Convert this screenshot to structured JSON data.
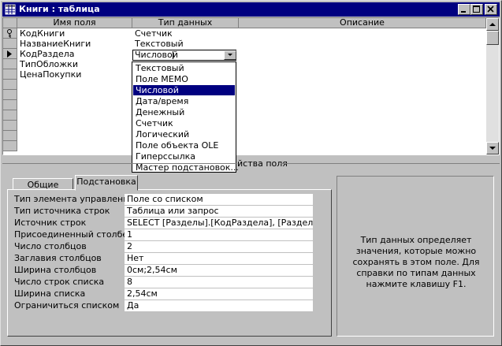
{
  "window": {
    "title": "Книги : таблица"
  },
  "grid": {
    "columns": [
      "Имя поля",
      "Тип данных",
      "Описание"
    ],
    "rows": [
      {
        "name": "КодКниги",
        "type": "Счетчик"
      },
      {
        "name": "НазваниеКниги",
        "type": "Текстовый"
      },
      {
        "name": "КодРаздела",
        "type": "Числовой"
      },
      {
        "name": "ТипОбложки",
        "type": ""
      },
      {
        "name": "ЦенаПокупки",
        "type": ""
      }
    ]
  },
  "dropdown": {
    "items": [
      "Текстовый",
      "Поле MEMO",
      "Числовой",
      "Дата/время",
      "Денежный",
      "Счетчик",
      "Логический",
      "Поле объекта OLE",
      "Гиперссылка",
      "Мастер подстановок..."
    ],
    "selected_index": 2
  },
  "props_label": "йства поля",
  "tabs": {
    "general": "Общие",
    "lookup": "Подстановка"
  },
  "properties": [
    {
      "label": "Тип элемента управления",
      "value": "Поле со списком"
    },
    {
      "label": "Тип источника строк",
      "value": "Таблица или запрос"
    },
    {
      "label": "Источник строк",
      "value": "SELECT [Разделы].[КодРаздела], [Разделы"
    },
    {
      "label": "Присоединенный столбец",
      "value": "1"
    },
    {
      "label": "Число столбцов",
      "value": "2"
    },
    {
      "label": "Заглавия столбцов",
      "value": "Нет"
    },
    {
      "label": "Ширина столбцов",
      "value": "0см;2,54см"
    },
    {
      "label": "Число строк списка",
      "value": "8"
    },
    {
      "label": "Ширина списка",
      "value": "2,54см"
    },
    {
      "label": "Ограничиться списком",
      "value": "Да"
    }
  ],
  "hint": "Тип данных определяет значения, которые можно сохранять в этом поле.  Для справки по типам данных нажмите клавишу F1.",
  "colors": {
    "titlebar": "#000080",
    "face": "#c0c0c0",
    "selection": "#000080"
  },
  "icons": {
    "table": "table-icon",
    "key": "primary-key-icon",
    "row_pointer": "row-pointer-icon"
  }
}
